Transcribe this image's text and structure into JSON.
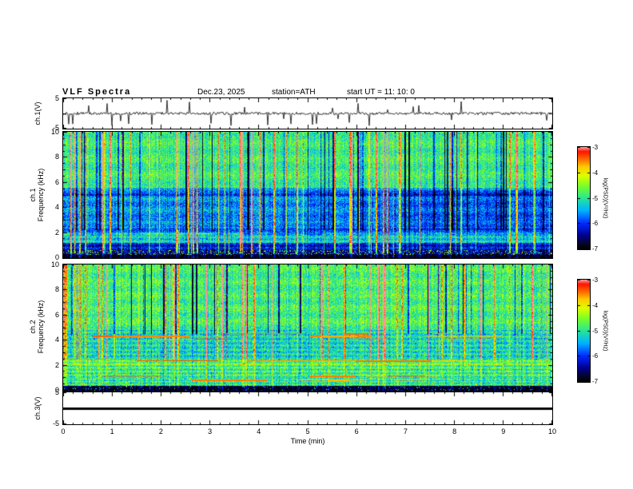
{
  "figure": {
    "title": "VLF Spectra",
    "date": "Dec.23, 2025",
    "station": "station=ATH",
    "start_ut": "start UT =  11: 10: 0"
  },
  "panels": {
    "wave": {
      "ylabel": "ch.1(V)"
    },
    "spec1": {
      "line1": "ch.1",
      "line2": "Frequency (kHz)"
    },
    "spec2": {
      "line1": "ch.2",
      "line2": "Frequency (kHz)"
    },
    "ch3": {
      "ylabel": "ch.3(V)"
    }
  },
  "axes": {
    "time_label": "Time  (min)",
    "time_ticks": [
      "0",
      "1",
      "2",
      "3",
      "4",
      "5",
      "6",
      "7",
      "8",
      "9",
      "10"
    ],
    "freq_ticks": [
      "10",
      "8",
      "6",
      "4",
      "2",
      "0"
    ],
    "volt_ticks": [
      "5",
      "-5"
    ]
  },
  "colorbar": {
    "label": "log(PSD)(V²/Hz)",
    "ticks": [
      "-3",
      "-4",
      "-5",
      "-6",
      "-7"
    ],
    "value_range": [
      -7,
      -3
    ],
    "scale_stops": [
      [
        0.0,
        "#000000"
      ],
      [
        0.05,
        "#050528"
      ],
      [
        0.13,
        "#00008c"
      ],
      [
        0.25,
        "#0028ff"
      ],
      [
        0.38,
        "#00b4ff"
      ],
      [
        0.5,
        "#28e696"
      ],
      [
        0.62,
        "#78ff28"
      ],
      [
        0.72,
        "#dcff00"
      ],
      [
        0.81,
        "#ffc800"
      ],
      [
        0.89,
        "#ff6400"
      ],
      [
        0.96,
        "#ff1400"
      ],
      [
        1.0,
        "#ff9696"
      ]
    ]
  },
  "chart_data": [
    {
      "type": "line",
      "title": "ch.1(V) time series",
      "xlabel": "Time (min)",
      "xlim": [
        0,
        10
      ],
      "ylabel": "ch.1(V)",
      "ylim": [
        -5,
        5
      ],
      "series": [
        {
          "name": "ch.1 voltage",
          "description": "broadband noise centered on 0 V with dense impulsive spikes (sferics) reaching about ±4 V across the full 10 minutes"
        }
      ]
    },
    {
      "type": "heatmap",
      "title": "ch.1 VLF spectrogram",
      "xlabel": "Time (min)",
      "xlim": [
        0,
        10
      ],
      "ylabel": "Frequency (kHz)",
      "ylim": [
        0,
        10
      ],
      "value_label": "log(PSD)(V²/Hz)",
      "value_range": [
        -7,
        -3
      ],
      "colormap": "rainbow, black at -7 through blue/cyan/green/yellow to red at -3",
      "features": [
        "green background near -4.5 above 5.5 kHz",
        "blue/cyan band near -5.5 to -6 between ~2.4 and 5.5 kHz, turning darker blue after ~4.5 min",
        "banded blue-cyan structure 1-2.4 kHz with a bright orange horizontal line near 1.9 kHz mostly in the first half",
        "dark blue below 1 kHz and a near-black strip below 0.3 kHz with multicolored speckle near 0.4 kHz",
        "dense vertical broadband red/orange sferic streaks reaching -3",
        "scattered dark-navy vertical dropout streaks above ~2 kHz",
        "faint dark horizontal notches near 2.1 and 5.0 kHz"
      ]
    },
    {
      "type": "heatmap",
      "title": "ch.2 VLF spectrogram",
      "xlabel": "Time (min)",
      "xlim": [
        0,
        10
      ],
      "ylabel": "Frequency (kHz)",
      "ylim": [
        0,
        10
      ],
      "value_label": "log(PSD)(V²/Hz)",
      "value_range": [
        -7,
        -3
      ],
      "colormap": "rainbow, black at -7 through blue/cyan/green/yellow to red at -3",
      "features": [
        "green background near -4.3 over most of the band",
        "strong yellow-green horizontal banding below ~2.6 kHz with orange speckle",
        "near-black strip below ~0.4 kHz",
        "red/brown horizontal transmitter/harmonic segments near 4.1-4.6, 2.3 and 1.1 kHz",
        "dense vertical red sferic streaks above ~2.5 kHz",
        "occasional dark-navy vertical dropout streaks above ~4.5 kHz"
      ]
    },
    {
      "type": "line",
      "title": "ch.3(V) time series",
      "xlabel": "Time (min)",
      "xlim": [
        0,
        10
      ],
      "ylabel": "ch.3(V)",
      "ylim": [
        -5,
        5
      ],
      "series": [
        {
          "name": "ch.3 voltage",
          "values": "constant 0 V (flat thick black line)"
        }
      ]
    }
  ]
}
